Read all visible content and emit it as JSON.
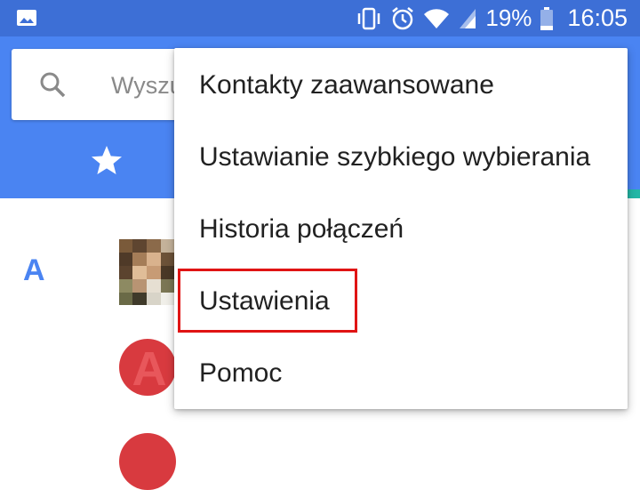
{
  "status_bar": {
    "battery_percent": "19%",
    "time": "16:05",
    "icons": [
      "gallery-icon",
      "vibrate-icon",
      "alarm-icon",
      "wifi-icon",
      "signal-icon",
      "battery-icon"
    ]
  },
  "search": {
    "placeholder": "Wyszu"
  },
  "tabs": {
    "favorites_icon": "star-icon"
  },
  "contacts": {
    "section_letter": "A",
    "avatar_initial": "A"
  },
  "overflow_menu": {
    "items": [
      {
        "label": "Kontakty zaawansowane"
      },
      {
        "label": "Ustawianie szybkiego wybierania"
      },
      {
        "label": "Historia połączeń"
      },
      {
        "label": "Ustawienia",
        "highlighted": true
      },
      {
        "label": "Pomoc"
      }
    ]
  },
  "colors": {
    "status_bar": "#3d6fd6",
    "app_bar": "#4a84f2",
    "accent_letter": "#4a84f2",
    "highlight_border": "#e01414",
    "avatar_red": "#d83a3f"
  }
}
